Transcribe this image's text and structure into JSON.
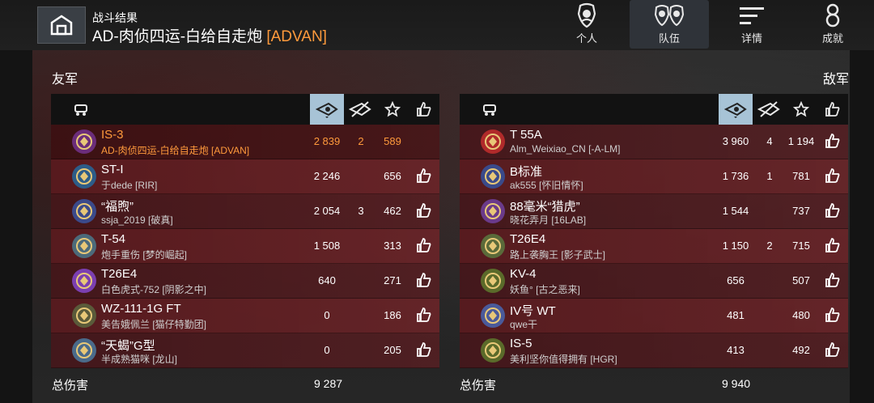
{
  "header": {
    "subtitle": "战斗结果",
    "title": "AD-肉侦四运-白给自走炮",
    "clan": "[ADVAN]"
  },
  "tabs": [
    {
      "label": "个人",
      "icon": "personal-crest-icon"
    },
    {
      "label": "队伍",
      "icon": "team-crest-icon"
    },
    {
      "label": "详情",
      "icon": "details-lines-icon"
    },
    {
      "label": "成就",
      "icon": "achievement-medal-icon"
    }
  ],
  "allies": {
    "label": "友军",
    "rows": [
      {
        "tank": "IS-3",
        "player": "AD-肉侦四运-白给自走炮 [ADVAN]",
        "damage": "2 839",
        "kills": "2",
        "xp": "589",
        "badge_color": "#6b2d7a",
        "highlight": true
      },
      {
        "tank": "ST-I",
        "player": "于dede [RIR]",
        "damage": "2 246",
        "kills": "",
        "xp": "656",
        "badge_color": "#2d5c88"
      },
      {
        "tank": "“福煦”",
        "player": "ssja_2019 [破真]",
        "damage": "2 054",
        "kills": "3",
        "xp": "462",
        "badge_color": "#3b4a8a"
      },
      {
        "tank": "T-54",
        "player": "炮手重伤 [梦的崛起]",
        "damage": "1 508",
        "kills": "",
        "xp": "313",
        "badge_color": "#4c6a7a"
      },
      {
        "tank": "T26E4",
        "player": "白色虎式-752 [阴影之中]",
        "damage": "640",
        "kills": "",
        "xp": "271",
        "badge_color": "#7b3fb0"
      },
      {
        "tank": "WZ-111-1G FT",
        "player": "美告娥佩兰 [猫仔特勤团]",
        "damage": "0",
        "kills": "",
        "xp": "186",
        "badge_color": "#5a5a3a"
      },
      {
        "tank": "“天蝎”G型",
        "player": "半成熟猫咪 [龙山]",
        "damage": "0",
        "kills": "",
        "xp": "205",
        "badge_color": "#4a6a8a"
      }
    ],
    "total_label": "总伤害",
    "total": "9 287"
  },
  "enemies": {
    "label": "敌军",
    "rows": [
      {
        "tank": "T 55A",
        "player": "Alm_Weixiao_CN [-A-LM]",
        "damage": "3 960",
        "kills": "4",
        "xp": "1 194",
        "badge_color": "#b02a2a"
      },
      {
        "tank": "B标准",
        "player": "ak555 [怀旧情怀]",
        "damage": "1 736",
        "kills": "1",
        "xp": "781",
        "badge_color": "#3a4a8a"
      },
      {
        "tank": "88毫米“猎虎”",
        "player": "晓花弄月 [16LAB]",
        "damage": "1 544",
        "kills": "",
        "xp": "737",
        "badge_color": "#6a3a8a"
      },
      {
        "tank": "T26E4",
        "player": "路上袭胸王 [影子武士]",
        "damage": "1 150",
        "kills": "2",
        "xp": "715",
        "badge_color": "#5a6a3a"
      },
      {
        "tank": "KV-4",
        "player": "妖鱼° [古之恶来]",
        "damage": "656",
        "kills": "",
        "xp": "507",
        "badge_color": "#5a6a2a"
      },
      {
        "tank": "IV号 WT",
        "player": "qwe干",
        "damage": "481",
        "kills": "",
        "xp": "480",
        "badge_color": "#4a5a9a"
      },
      {
        "tank": "IS-5",
        "player": "美利坚你值得拥有 [HGR]",
        "damage": "413",
        "kills": "",
        "xp": "492",
        "badge_color": "#5a6a2a"
      }
    ],
    "total_label": "总伤害",
    "total": "9 940"
  },
  "colors": {
    "accent": "#ff9a3c",
    "sort_active": "#a7c3d6",
    "row_red": "#6e2428"
  }
}
